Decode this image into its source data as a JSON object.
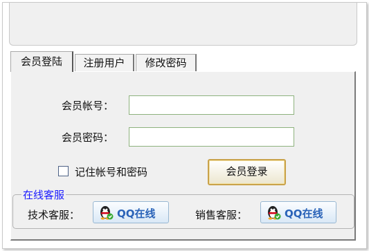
{
  "tabs": [
    {
      "label": "会员登陆",
      "active": true
    },
    {
      "label": "注册用户",
      "active": false
    },
    {
      "label": "修改密码",
      "active": false
    }
  ],
  "login": {
    "account_label": "会员帐号：",
    "account_value": "",
    "password_label": "会员密码：",
    "password_value": "",
    "remember_label": "记住帐号和密码",
    "remember_checked": false,
    "login_button": "会员登录"
  },
  "service": {
    "title": "在线客服",
    "tech_label": "技术客服：",
    "sales_label": "销售客服：",
    "qq_button_label": "QQ在线",
    "qq_icon": "qq-penguin-icon"
  },
  "colors": {
    "accent_blue": "#1a1aff",
    "login_border": "#c9a24a",
    "input_border": "#8db27d"
  }
}
